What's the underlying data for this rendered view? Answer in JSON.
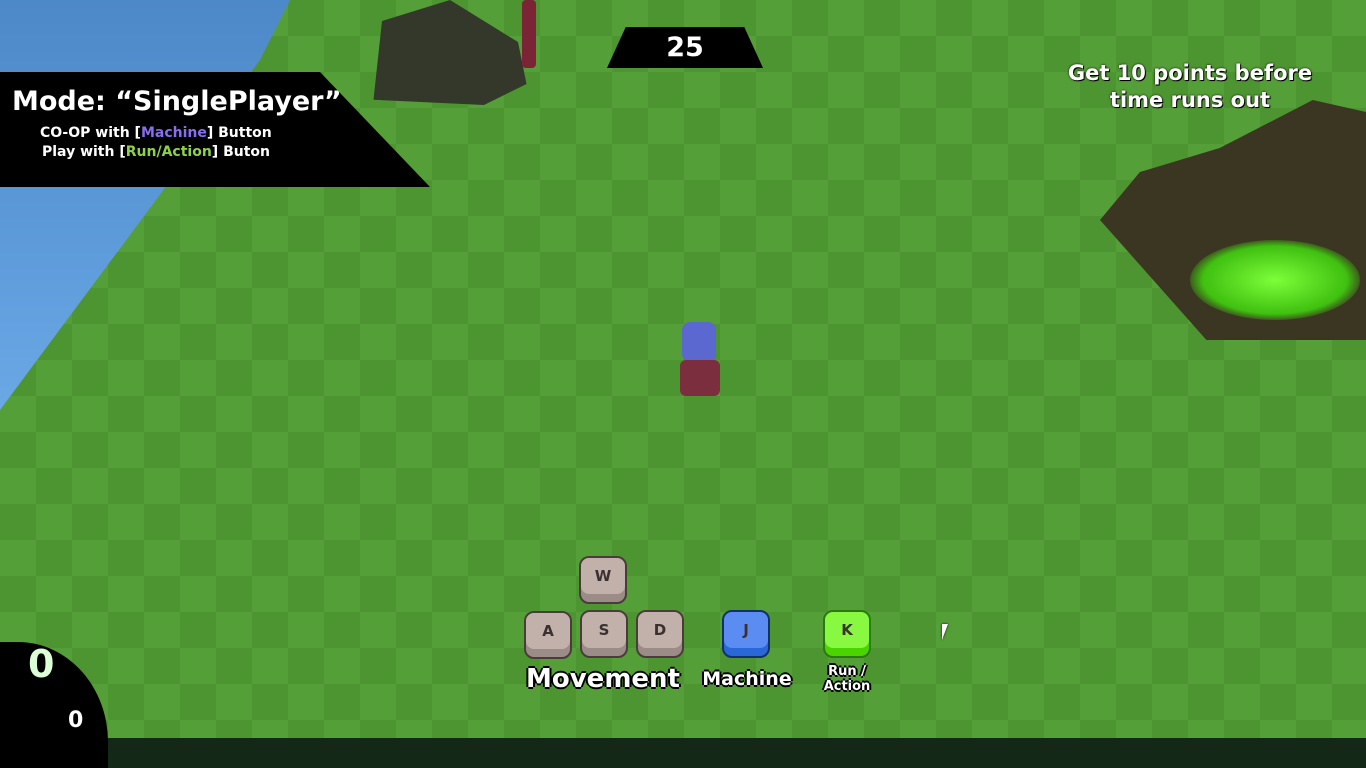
{
  "timer": "25",
  "mode": {
    "title": "Mode: “SinglePlayer”",
    "coop_prefix": "CO-OP with [",
    "coop_highlight": "Machine",
    "coop_suffix": "] Button",
    "play_prefix": "Play with [",
    "play_highlight": "Run/Action",
    "play_suffix": "] Buton"
  },
  "goal": {
    "line1": "Get 10 points before",
    "line2": "time runs out"
  },
  "controls": {
    "w": "W",
    "a": "A",
    "s": "S",
    "d": "D",
    "j": "J",
    "k": "K",
    "movement": "Movement",
    "machine": "Machine",
    "run_line1": "Run /",
    "run_line2": "Action"
  },
  "score": {
    "primary": "0",
    "secondary": "0"
  },
  "colors": {
    "machine": "#8a6cf0",
    "run": "#8fd24a",
    "key_j": "#4a7ef0",
    "key_k": "#66f020"
  }
}
